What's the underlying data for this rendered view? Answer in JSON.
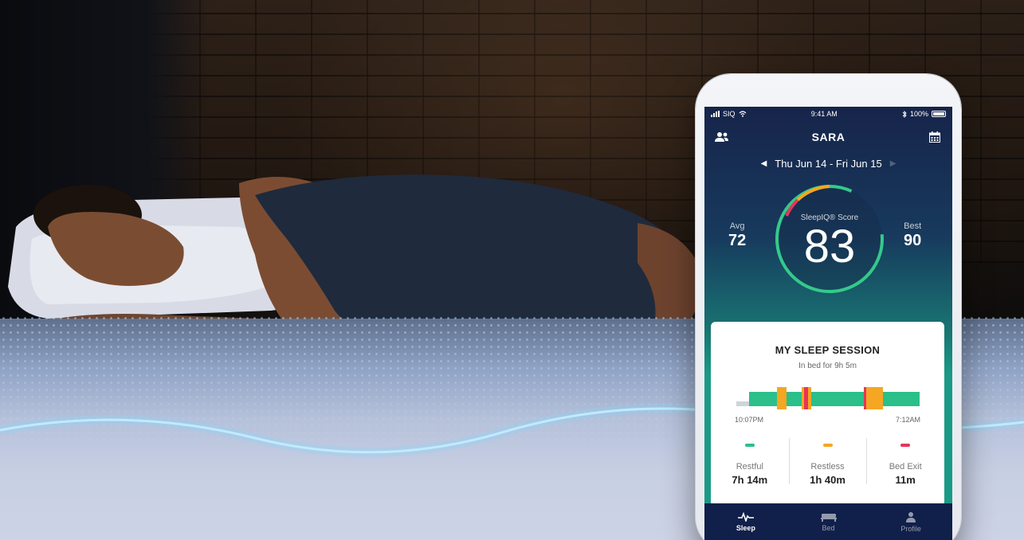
{
  "status_bar": {
    "carrier": "SIQ",
    "time": "9:41 AM",
    "battery": "100%"
  },
  "header": {
    "title": "SARA",
    "sleepers_icon": "sleepers-icon",
    "calendar_icon": "calendar-icon"
  },
  "date_nav": {
    "range": "Thu Jun 14 - Fri Jun 15",
    "prev_icon": "chevron-left-icon",
    "next_icon": "chevron-right-icon"
  },
  "score": {
    "label": "SleepIQ® Score",
    "value": "83",
    "avg_label": "Avg",
    "avg_value": "72",
    "best_label": "Best",
    "best_value": "90"
  },
  "session": {
    "title": "MY SLEEP SESSION",
    "subtitle": "In bed for 9h 5m",
    "start_time": "10:07PM",
    "end_time": "7:12AM",
    "legend": [
      {
        "label": "Restful",
        "value": "7h 14m",
        "color": "#2bbf8a"
      },
      {
        "label": "Restless",
        "value": "1h 40m",
        "color": "#f5a623"
      },
      {
        "label": "Bed Exit",
        "value": "11m",
        "color": "#e5365a"
      }
    ]
  },
  "tabs": [
    {
      "label": "Sleep",
      "icon": "pulse-icon",
      "active": true
    },
    {
      "label": "Bed",
      "icon": "bed-icon",
      "active": false
    },
    {
      "label": "Profile",
      "icon": "person-icon",
      "active": false
    }
  ],
  "colors": {
    "restful": "#2bbf8a",
    "restless": "#f5a623",
    "bed_exit": "#e5365a",
    "gauge_ring": "#35c98b",
    "tab_bar": "#11204a"
  }
}
